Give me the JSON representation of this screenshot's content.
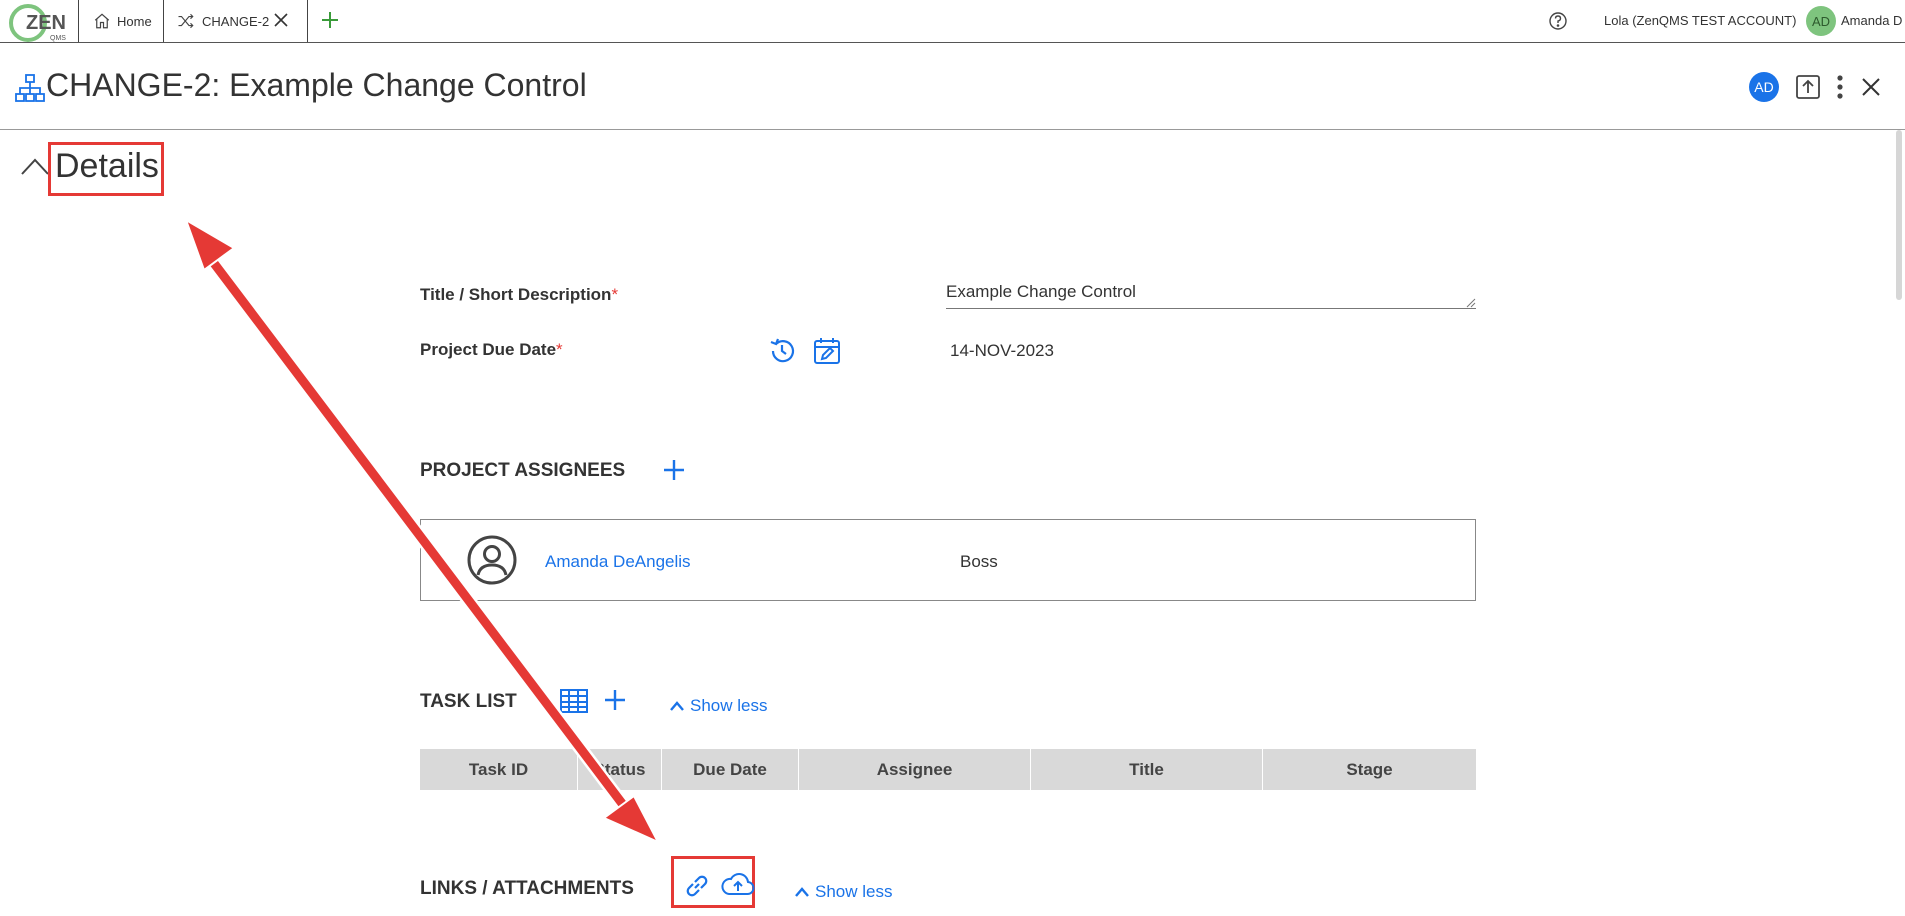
{
  "app": {
    "logo_text": "ZEN",
    "logo_sub": "QMS"
  },
  "tabs": [
    {
      "label": "Home",
      "icon": "home-icon"
    },
    {
      "label": "CHANGE-2",
      "icon": "shuffle-icon"
    }
  ],
  "topbar": {
    "account": "Lola (ZenQMS TEST ACCOUNT)",
    "avatar_initials": "AD",
    "user_name": "Amanda D"
  },
  "header": {
    "title": "CHANGE-2: Example Change Control",
    "avatar_initials": "AD"
  },
  "details": {
    "heading": "Details",
    "title_label": "Title / Short Description",
    "title_value": "Example Change Control",
    "due_label": "Project Due Date",
    "required_marker": "*",
    "due_value": "14-NOV-2023"
  },
  "assignees": {
    "heading": "PROJECT ASSIGNEES",
    "items": [
      {
        "name": "Amanda DeAngelis",
        "role": "Boss"
      }
    ]
  },
  "tasks": {
    "heading": "TASK LIST",
    "show_less": "Show less",
    "columns": [
      "Task ID",
      "Status",
      "Due Date",
      "Assignee",
      "Title",
      "Stage"
    ]
  },
  "links": {
    "heading": "LINKS / ATTACHMENTS",
    "show_less": "Show less"
  },
  "colors": {
    "accent": "#1a73e8",
    "highlight": "#e53935",
    "avatar_green": "#7ec47e"
  }
}
